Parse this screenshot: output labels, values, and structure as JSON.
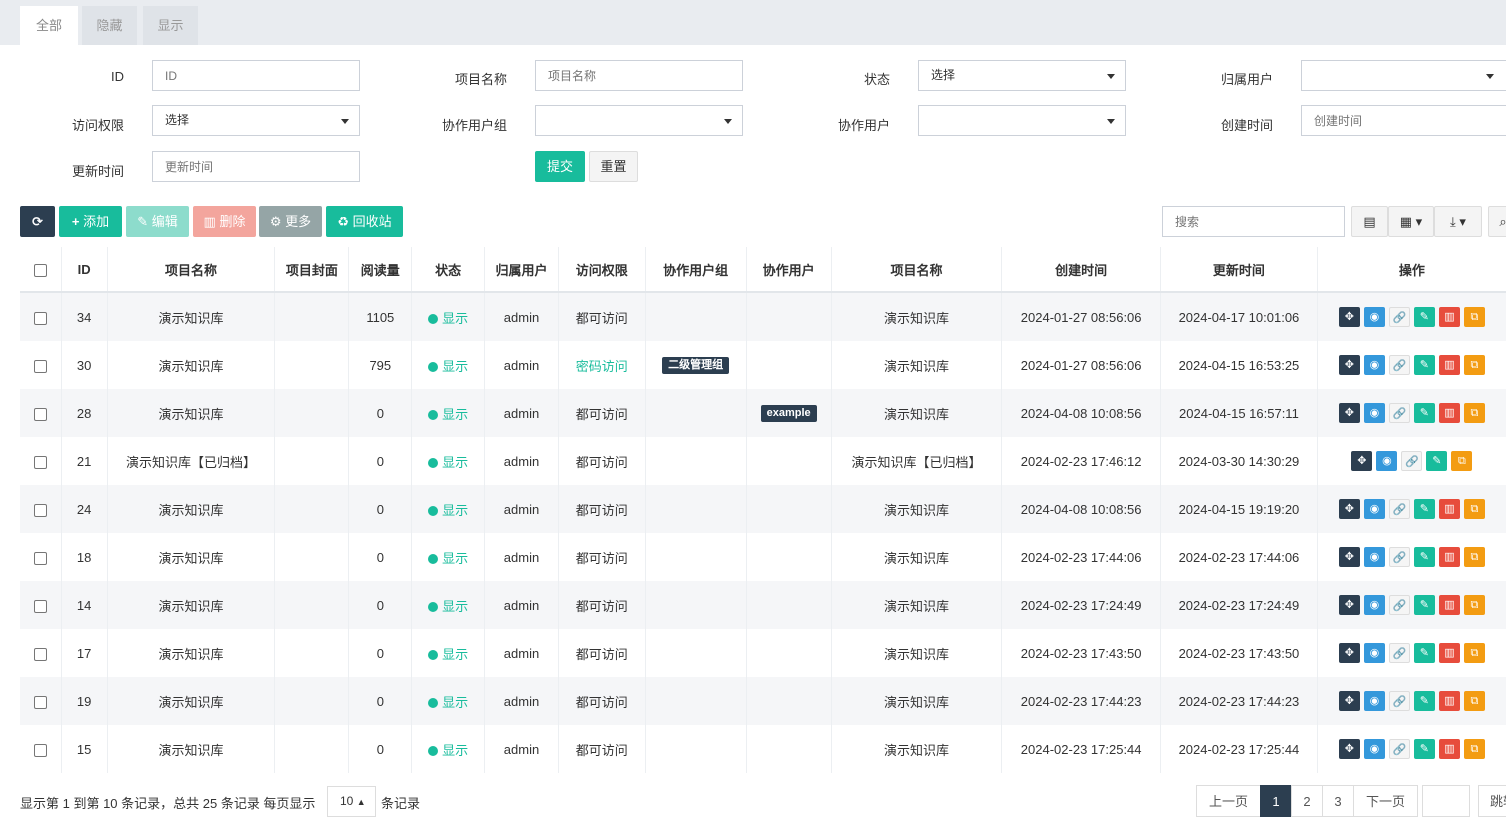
{
  "tabs": [
    "全部",
    "隐藏",
    "显示"
  ],
  "filters": {
    "id_label": "ID",
    "id_placeholder": "ID",
    "name_label": "项目名称",
    "name_placeholder": "项目名称",
    "status_label": "状态",
    "status_value": "选择",
    "owner_label": "归属用户",
    "owner_value": "",
    "access_label": "访问权限",
    "access_value": "选择",
    "group_label": "协作用户组",
    "group_value": "",
    "user_label": "协作用户",
    "user_value": "",
    "created_label": "创建时间",
    "created_placeholder": "创建时间",
    "updated_label": "更新时间",
    "updated_placeholder": "更新时间",
    "submit": "提交",
    "reset": "重置"
  },
  "toolbar": {
    "refresh_icon": "refresh-icon",
    "add": "添加",
    "edit": "编辑",
    "delete": "删除",
    "more": "更多",
    "recycle": "回收站",
    "search_placeholder": "搜索"
  },
  "table": {
    "headers": [
      "ID",
      "项目名称",
      "项目封面",
      "阅读量",
      "状态",
      "归属用户",
      "访问权限",
      "协作用户组",
      "协作用户",
      "项目名称",
      "创建时间",
      "更新时间",
      "操作"
    ],
    "rows": [
      {
        "id": "34",
        "name": "演示知识库",
        "cover": "",
        "views": "1105",
        "status": "显示",
        "owner": "admin",
        "access": "都可访问",
        "group": "",
        "user": "",
        "name2": "演示知识库",
        "created": "2024-01-27 08:56:06",
        "updated": "2024-04-17 10:01:06"
      },
      {
        "id": "30",
        "name": "演示知识库",
        "cover": "",
        "views": "795",
        "status": "显示",
        "owner": "admin",
        "access": "密码访问",
        "group": "二级管理组",
        "user": "",
        "name2": "演示知识库",
        "created": "2024-01-27 08:56:06",
        "updated": "2024-04-15 16:53:25"
      },
      {
        "id": "28",
        "name": "演示知识库",
        "cover": "",
        "views": "0",
        "status": "显示",
        "owner": "admin",
        "access": "都可访问",
        "group": "",
        "user": "example",
        "name2": "演示知识库",
        "created": "2024-04-08 10:08:56",
        "updated": "2024-04-15 16:57:11"
      },
      {
        "id": "21",
        "name": "演示知识库【已归档】",
        "cover": "",
        "views": "0",
        "status": "显示",
        "owner": "admin",
        "access": "都可访问",
        "group": "",
        "user": "",
        "name2": "演示知识库【已归档】",
        "created": "2024-02-23 17:46:12",
        "updated": "2024-03-30 14:30:29"
      },
      {
        "id": "24",
        "name": "演示知识库",
        "cover": "",
        "views": "0",
        "status": "显示",
        "owner": "admin",
        "access": "都可访问",
        "group": "",
        "user": "",
        "name2": "演示知识库",
        "created": "2024-04-08 10:08:56",
        "updated": "2024-04-15 19:19:20"
      },
      {
        "id": "18",
        "name": "演示知识库",
        "cover": "",
        "views": "0",
        "status": "显示",
        "owner": "admin",
        "access": "都可访问",
        "group": "",
        "user": "",
        "name2": "演示知识库",
        "created": "2024-02-23 17:44:06",
        "updated": "2024-02-23 17:44:06"
      },
      {
        "id": "14",
        "name": "演示知识库",
        "cover": "",
        "views": "0",
        "status": "显示",
        "owner": "admin",
        "access": "都可访问",
        "group": "",
        "user": "",
        "name2": "演示知识库",
        "created": "2024-02-23 17:24:49",
        "updated": "2024-02-23 17:24:49"
      },
      {
        "id": "17",
        "name": "演示知识库",
        "cover": "",
        "views": "0",
        "status": "显示",
        "owner": "admin",
        "access": "都可访问",
        "group": "",
        "user": "",
        "name2": "演示知识库",
        "created": "2024-02-23 17:43:50",
        "updated": "2024-02-23 17:43:50"
      },
      {
        "id": "19",
        "name": "演示知识库",
        "cover": "",
        "views": "0",
        "status": "显示",
        "owner": "admin",
        "access": "都可访问",
        "group": "",
        "user": "",
        "name2": "演示知识库",
        "created": "2024-02-23 17:44:23",
        "updated": "2024-02-23 17:44:23"
      },
      {
        "id": "15",
        "name": "演示知识库",
        "cover": "",
        "views": "0",
        "status": "显示",
        "owner": "admin",
        "access": "都可访问",
        "group": "",
        "user": "",
        "name2": "演示知识库",
        "created": "2024-02-23 17:25:44",
        "updated": "2024-02-23 17:25:44"
      }
    ]
  },
  "pagination": {
    "info_prefix": "显示第 1 到第 10 条记录，总共 25 条记录 每页显示",
    "page_size": "10",
    "info_suffix": "条记录",
    "prev": "上一页",
    "pages": [
      "1",
      "2",
      "3"
    ],
    "current": "1",
    "next": "下一页",
    "jump": "跳转"
  },
  "colors": {
    "primary": "#2c3e50",
    "success": "#18bc9c",
    "danger": "#e74c3c",
    "info": "#3498db",
    "warning": "#f39c12"
  }
}
